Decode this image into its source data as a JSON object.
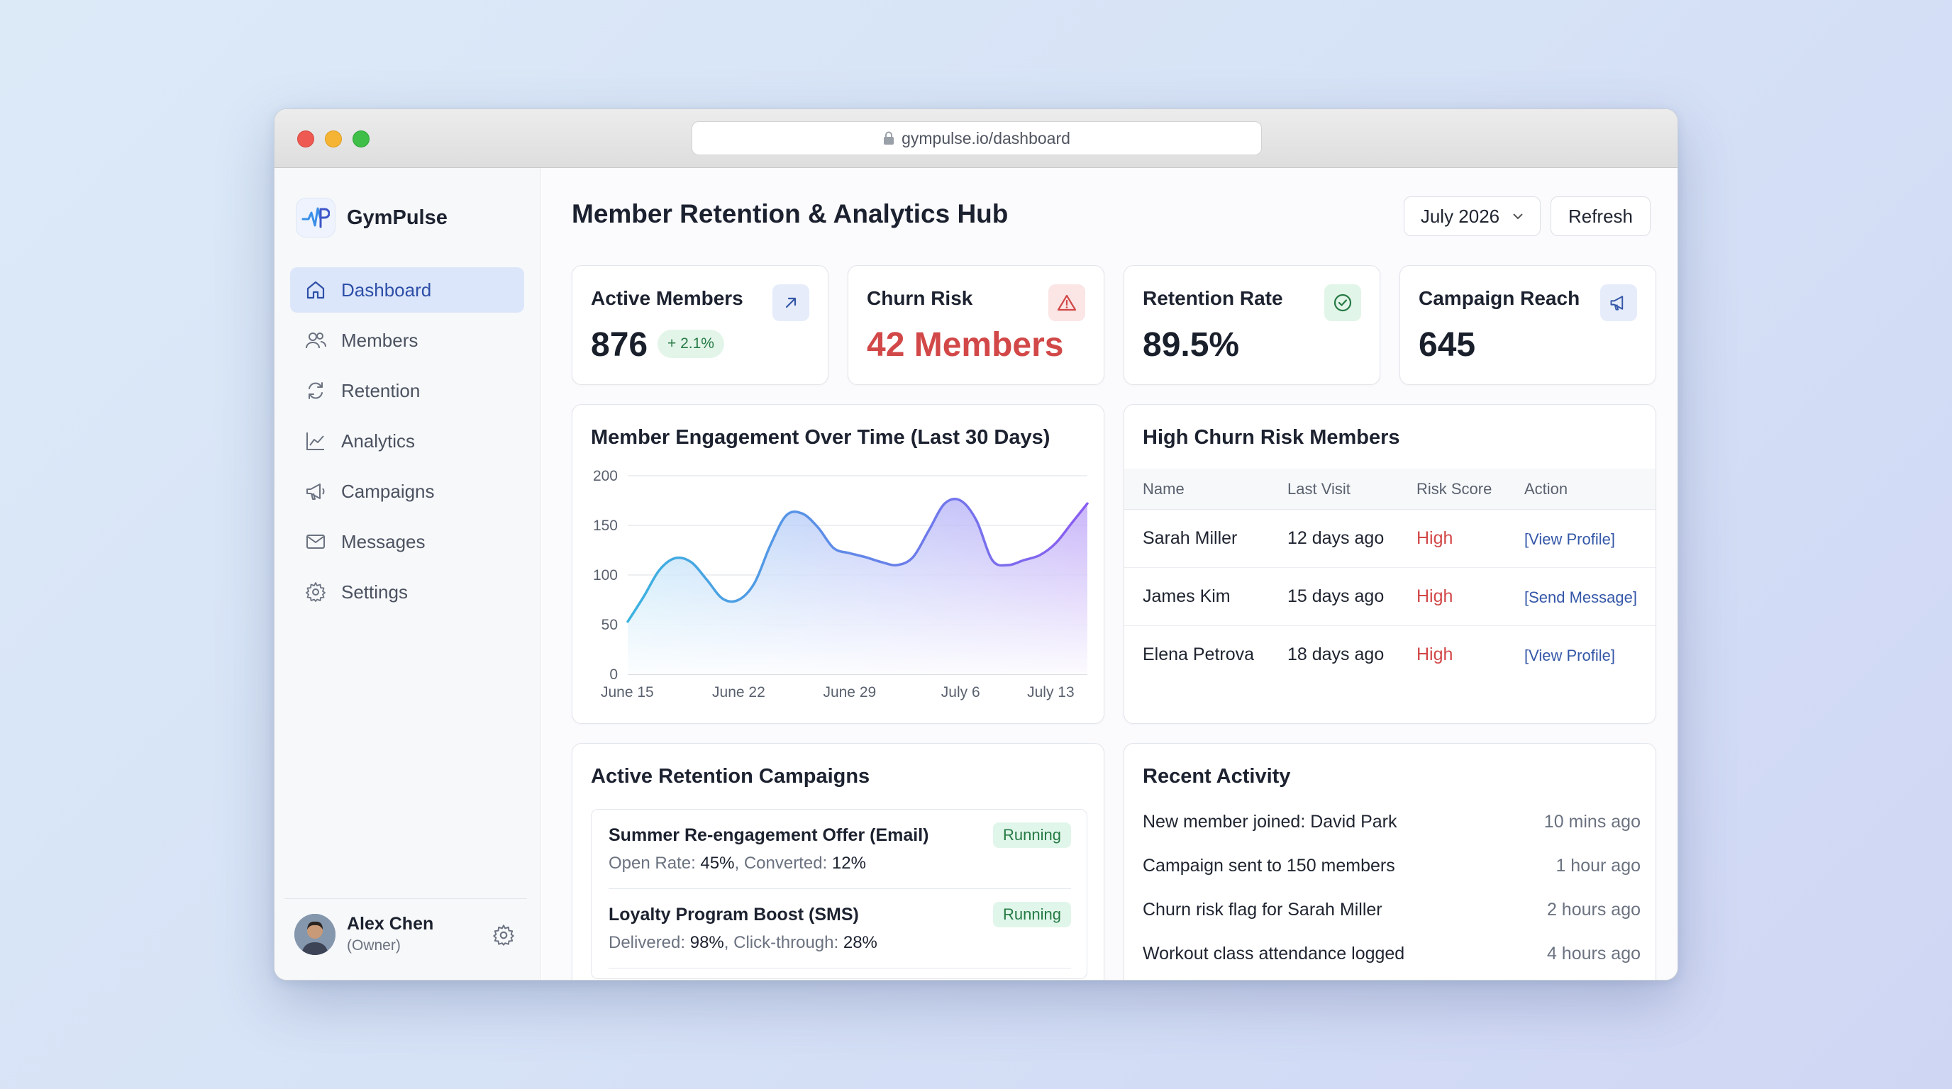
{
  "browser": {
    "url": "gympulse.io/dashboard"
  },
  "brand": {
    "name": "GymPulse"
  },
  "nav": [
    {
      "label": "Dashboard",
      "icon": "home-icon"
    },
    {
      "label": "Members",
      "icon": "users-icon"
    },
    {
      "label": "Retention",
      "icon": "refresh-icon"
    },
    {
      "label": "Analytics",
      "icon": "chart-line-icon"
    },
    {
      "label": "Campaigns",
      "icon": "megaphone-icon"
    },
    {
      "label": "Messages",
      "icon": "mail-icon"
    },
    {
      "label": "Settings",
      "icon": "gear-icon"
    }
  ],
  "user": {
    "name": "Alex Chen",
    "role": "(Owner)"
  },
  "header": {
    "title": "Member Retention & Analytics Hub",
    "month": "July 2026",
    "refresh_label": "Refresh"
  },
  "kpis": [
    {
      "label": "Active Members",
      "value": "876",
      "badge": "+ 2.1%",
      "icon": "arrow-up-right-icon"
    },
    {
      "label": "Churn Risk",
      "value": "42 Members",
      "icon": "alert-triangle-icon"
    },
    {
      "label": "Retention Rate",
      "value": "89.5%",
      "icon": "check-circle-icon"
    },
    {
      "label": "Campaign Reach",
      "value": "645",
      "icon": "megaphone-icon"
    }
  ],
  "engagement": {
    "title": "Member Engagement Over Time (Last 30 Days)"
  },
  "chart_data": {
    "type": "area",
    "title": "Member Engagement Over Time (Last 30 Days)",
    "x": [
      "June 15",
      "June 16",
      "June 17",
      "June 18",
      "June 19",
      "June 20",
      "June 21",
      "June 22",
      "June 23",
      "June 24",
      "June 25",
      "June 26",
      "June 27",
      "June 28",
      "June 29",
      "June 30",
      "July 1",
      "July 2",
      "July 3",
      "July 4",
      "July 5",
      "July 6",
      "July 7",
      "July 8",
      "July 9",
      "July 10",
      "July 11",
      "July 12",
      "July 13",
      "July 14"
    ],
    "values": [
      53,
      78,
      105,
      117,
      113,
      95,
      76,
      75,
      92,
      130,
      160,
      162,
      148,
      127,
      122,
      118,
      113,
      110,
      118,
      145,
      172,
      175,
      155,
      115,
      110,
      115,
      120,
      132,
      152,
      172
    ],
    "xticks": [
      "June 15",
      "June 22",
      "June 29",
      "July 6",
      "July 13"
    ],
    "yticks": [
      0,
      50,
      100,
      150,
      200
    ],
    "ylim": [
      0,
      200
    ],
    "xlabel": "",
    "ylabel": "",
    "grid": true,
    "colors": {
      "line_start": "#3bb3e0",
      "line_end": "#8a5cf0",
      "fill_start": "#9fd8f5",
      "fill_end": "#b79cf7"
    }
  },
  "churn_table": {
    "title": "High Churn Risk Members",
    "columns": [
      "Name",
      "Last Visit",
      "Risk Score",
      "Action"
    ],
    "rows": [
      {
        "name": "Sarah Miller",
        "last_visit": "12 days ago",
        "risk": "High",
        "action": "[View Profile]"
      },
      {
        "name": "James Kim",
        "last_visit": "15 days ago",
        "risk": "High",
        "action": "[Send Message]"
      },
      {
        "name": "Elena Petrova",
        "last_visit": "18 days ago",
        "risk": "High",
        "action": "[View Profile]"
      }
    ]
  },
  "campaigns": {
    "title": "Active Retention Campaigns",
    "items": [
      {
        "name": "Summer Re-engagement Offer (Email)",
        "status": "Running",
        "m1_label": "Open Rate:",
        "m1_value": "45%",
        "m2_label": "Converted:",
        "m2_value": "12%"
      },
      {
        "name": "Loyalty Program Boost (SMS)",
        "status": "Running",
        "m1_label": "Delivered:",
        "m1_value": "98%",
        "m2_label": "Click-through:",
        "m2_value": "28%"
      }
    ]
  },
  "activity": {
    "title": "Recent Activity",
    "items": [
      {
        "text": "New member joined: David Park",
        "time": "10 mins ago"
      },
      {
        "text": "Campaign sent to 150 members",
        "time": "1 hour ago"
      },
      {
        "text": "Churn risk flag for Sarah Miller",
        "time": "2 hours ago"
      },
      {
        "text": "Workout class attendance logged",
        "time": "4 hours ago"
      }
    ]
  },
  "colors": {
    "accent": "#2d4fa8",
    "danger": "#d24848",
    "success": "#267a45"
  }
}
